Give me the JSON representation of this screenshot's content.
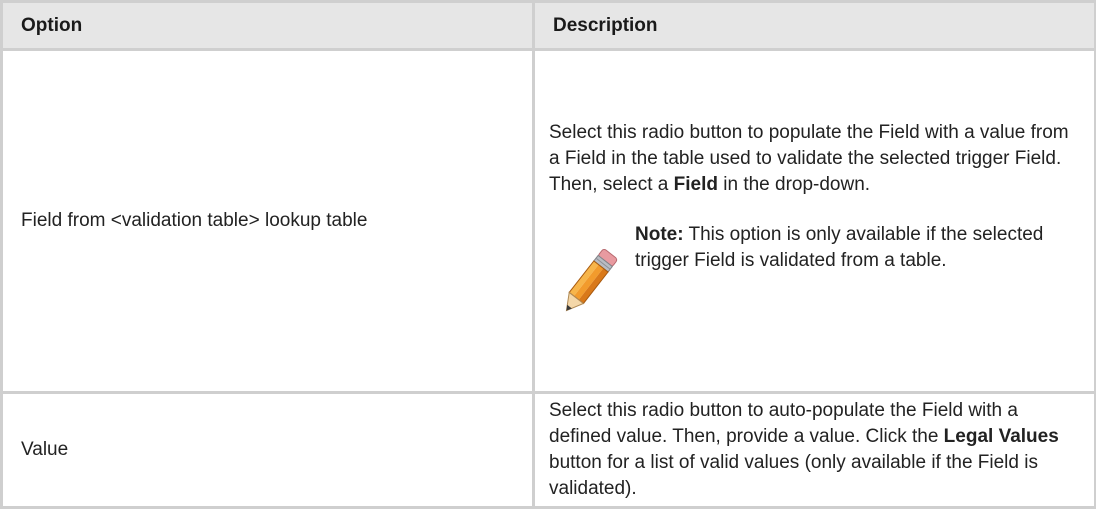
{
  "table": {
    "headers": {
      "option": "Option",
      "description": "Description"
    },
    "rows": [
      {
        "option": "Field from <validation table> lookup table",
        "desc_before": "Select this radio button to populate the Field with a value from a Field in the table used to validate the selected trigger Field. Then, select a ",
        "desc_bold": "Field",
        "desc_after": " in the drop-down.",
        "note": {
          "icon": "pencil-icon",
          "label": "Note:",
          "text": " This option is only available if the selected trigger Field is validated from a table."
        }
      },
      {
        "option": "Value",
        "desc_before": "Select this radio button to auto-populate the Field with a defined value. Then, provide a value. Click the ",
        "desc_bold": "Legal Values",
        "desc_after": " button for a list of valid values (only available if the Field is validated)."
      }
    ]
  },
  "colors": {
    "header_background": "#e6e6e6",
    "border": "#cfcfcf",
    "text": "#222222"
  }
}
